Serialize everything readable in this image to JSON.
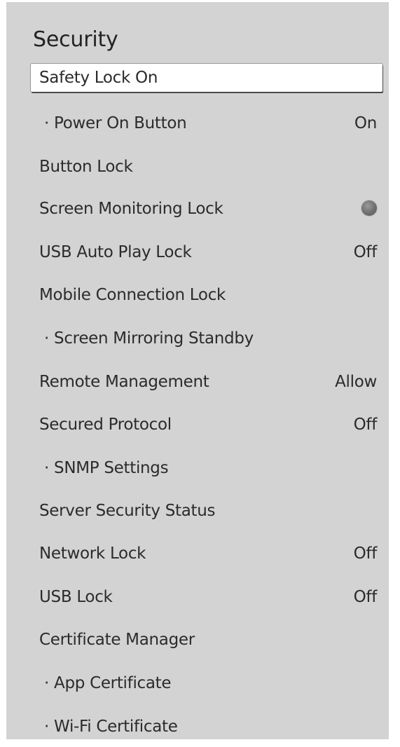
{
  "title": "Security",
  "menu": [
    {
      "label": "Safety Lock On",
      "value": "",
      "sub": false,
      "focused": true
    },
    {
      "label": "· Power On Button",
      "value": "On",
      "sub": true
    },
    {
      "label": "Button Lock",
      "value": "",
      "sub": false
    },
    {
      "label": "Screen Monitoring Lock",
      "value": "",
      "sub": false,
      "toggle": "off-dot"
    },
    {
      "label": "USB Auto Play Lock",
      "value": "Off",
      "sub": false
    },
    {
      "label": "Mobile Connection Lock",
      "value": "",
      "sub": false
    },
    {
      "label": "· Screen Mirroring Standby",
      "value": "",
      "sub": true
    },
    {
      "label": "Remote Management",
      "value": "Allow",
      "sub": false
    },
    {
      "label": "Secured Protocol",
      "value": "Off",
      "sub": false
    },
    {
      "label": "· SNMP Settings",
      "value": "",
      "sub": true
    },
    {
      "label": "Server Security Status",
      "value": "",
      "sub": false
    },
    {
      "label": "Network Lock",
      "value": "Off",
      "sub": false
    },
    {
      "label": "USB Lock",
      "value": "Off",
      "sub": false
    },
    {
      "label": "Certificate Manager",
      "value": "",
      "sub": false
    },
    {
      "label": "· App Certificate",
      "value": "",
      "sub": true
    },
    {
      "label": "· Wi-Fi Certificate",
      "value": "",
      "sub": true
    }
  ]
}
